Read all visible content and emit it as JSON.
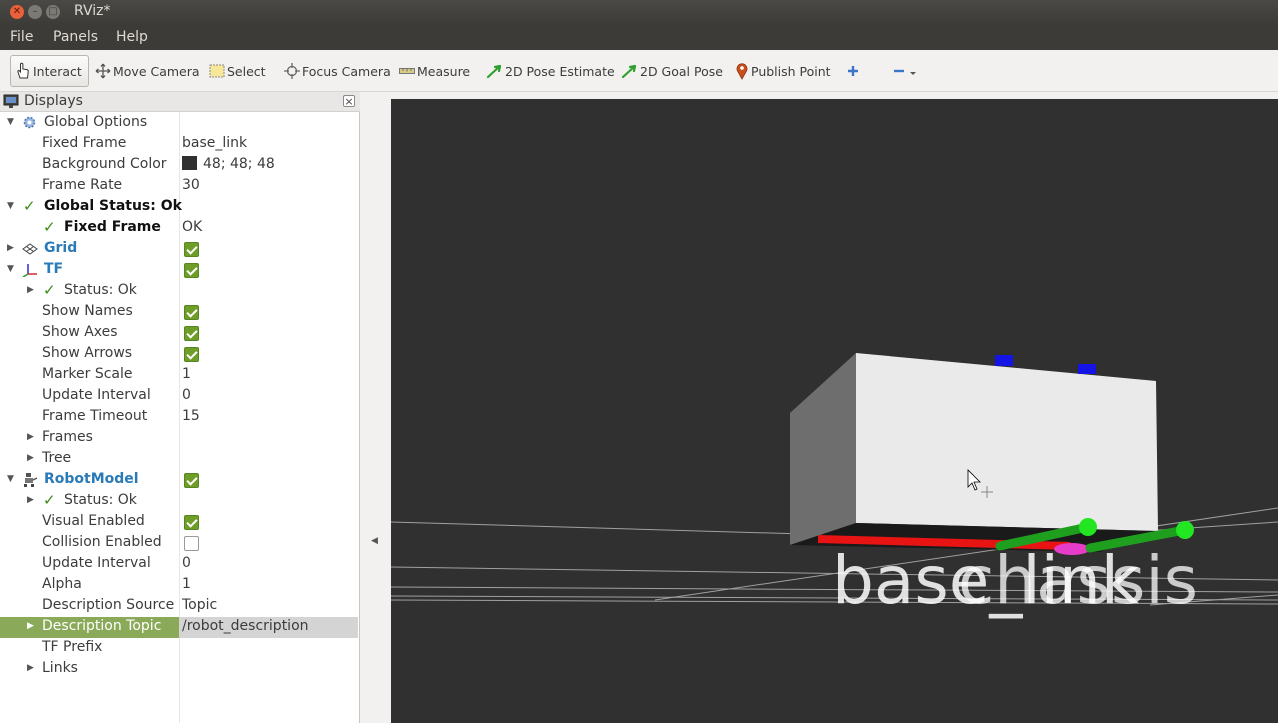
{
  "window": {
    "title": "RViz*"
  },
  "menu": {
    "file": "File",
    "panels": "Panels",
    "help": "Help"
  },
  "toolbar": {
    "interact": "Interact",
    "move_camera": "Move Camera",
    "select": "Select",
    "focus_camera": "Focus Camera",
    "measure": "Measure",
    "pose_estimate": "2D Pose Estimate",
    "goal_pose": "2D Goal Pose",
    "publish_point": "Publish Point"
  },
  "displays": {
    "title": "Displays",
    "global_options": {
      "label": "Global Options",
      "fixed_frame_label": "Fixed Frame",
      "fixed_frame_value": "base_link",
      "bg_color_label": "Background Color",
      "bg_color_value": "48; 48; 48",
      "bg_color_hex": "#303030",
      "frame_rate_label": "Frame Rate",
      "frame_rate_value": "30"
    },
    "global_status": {
      "label": "Global Status: Ok",
      "fixed_frame_label": "Fixed Frame",
      "fixed_frame_value": "OK"
    },
    "grid": {
      "label": "Grid",
      "enabled": true
    },
    "tf": {
      "label": "TF",
      "enabled": true,
      "status_label": "Status: Ok",
      "show_names_label": "Show Names",
      "show_names": true,
      "show_axes_label": "Show Axes",
      "show_axes": true,
      "show_arrows_label": "Show Arrows",
      "show_arrows": true,
      "marker_scale_label": "Marker Scale",
      "marker_scale_value": "1",
      "update_interval_label": "Update Interval",
      "update_interval_value": "0",
      "frame_timeout_label": "Frame Timeout",
      "frame_timeout_value": "15",
      "frames_label": "Frames",
      "tree_label": "Tree"
    },
    "robot_model": {
      "label": "RobotModel",
      "enabled": true,
      "status_label": "Status: Ok",
      "visual_enabled_label": "Visual Enabled",
      "visual_enabled": true,
      "collision_enabled_label": "Collision Enabled",
      "collision_enabled": false,
      "update_interval_label": "Update Interval",
      "update_interval_value": "0",
      "alpha_label": "Alpha",
      "alpha_value": "1",
      "description_source_label": "Description Source",
      "description_source_value": "Topic",
      "description_topic_label": "Description Topic",
      "description_topic_value": "/robot_description",
      "tf_prefix_label": "TF Prefix",
      "links_label": "Links"
    }
  },
  "scene": {
    "frame_label_1": "base_link",
    "frame_label_2": "chassis"
  }
}
